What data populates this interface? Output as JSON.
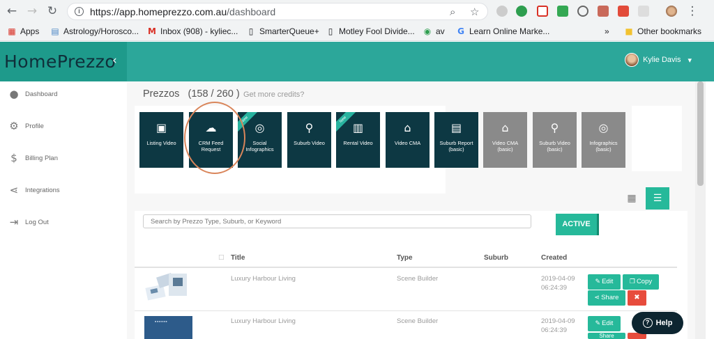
{
  "browser": {
    "url_host": "https://app.homeprezzo.com.au",
    "url_path": "/dashboard",
    "bookmarks": [
      {
        "label": "Apps"
      },
      {
        "label": "Astrology/Horosco..."
      },
      {
        "label": "Inbox (908) - kyliec..."
      },
      {
        "label": "SmarterQueue+"
      },
      {
        "label": "Motley Fool Divide..."
      },
      {
        "label": "av"
      },
      {
        "label": "Learn Online Marke..."
      },
      {
        "label": "»"
      },
      {
        "label": "Other bookmarks"
      }
    ]
  },
  "app": {
    "logo": "HomePrezzo",
    "user_name": "Kylie Davis"
  },
  "sidebar": {
    "items": [
      {
        "label": "Dashboard",
        "icon": "user-icon"
      },
      {
        "label": "Profile",
        "icon": "gear-icon"
      },
      {
        "label": "Billing Plan",
        "icon": "dollar-icon"
      },
      {
        "label": "Integrations",
        "icon": "share-icon"
      },
      {
        "label": "Log Out",
        "icon": "logout-icon"
      }
    ]
  },
  "main": {
    "title": "Prezzos",
    "count": "(158 / 260 )",
    "credits_link": "Get more credits?",
    "tiles": [
      {
        "label": "Listing Video",
        "icon": "film-icon",
        "style": "dark"
      },
      {
        "label": "CRM Feed Request",
        "icon": "cloud-upload-icon",
        "style": "dark"
      },
      {
        "label": "Social Infographics",
        "icon": "instagram-icon",
        "style": "dark",
        "badge": "New"
      },
      {
        "label": "Suburb Video",
        "icon": "map-pin-icon",
        "style": "dark"
      },
      {
        "label": "Rental Video",
        "icon": "building-icon",
        "style": "dark",
        "badge": "New"
      },
      {
        "label": "Video CMA",
        "icon": "home-icon",
        "style": "dark"
      },
      {
        "label": "Suburb Report (basic)",
        "icon": "pdf-icon",
        "style": "dark"
      },
      {
        "label": "Video CMA (basic)",
        "icon": "home-icon",
        "style": "grey"
      },
      {
        "label": "Suburb Video (basic)",
        "icon": "map-pin-icon",
        "style": "grey"
      },
      {
        "label": "Infographics (basic)",
        "icon": "instagram-icon",
        "style": "grey"
      }
    ],
    "search_placeholder": "Search by Prezzo Type, Suburb, or Keyword",
    "active_label": "ACTIVE",
    "table": {
      "headers": {
        "title": "Title",
        "type": "Type",
        "suburb": "Suburb",
        "created": "Created"
      },
      "rows": [
        {
          "title": "Luxury Harbour Living",
          "type": "Scene Builder",
          "suburb": "",
          "created_date": "2019-04-09",
          "created_time": "06:24:39"
        },
        {
          "title": "Luxury Harbour Living",
          "type": "Scene Builder",
          "suburb": "",
          "created_date": "2019-04-09",
          "created_time": "06:24:39"
        }
      ]
    },
    "actions": {
      "edit": "Edit",
      "copy": "Copy",
      "share": "Share"
    },
    "help_label": "Help"
  },
  "colors": {
    "brand": "#2ca79a",
    "tile_dark": "#0d3843",
    "tile_grey": "#8a8a8a",
    "accent": "#26b99a",
    "danger": "#e74c3c",
    "highlight_circle": "#d9855a"
  }
}
